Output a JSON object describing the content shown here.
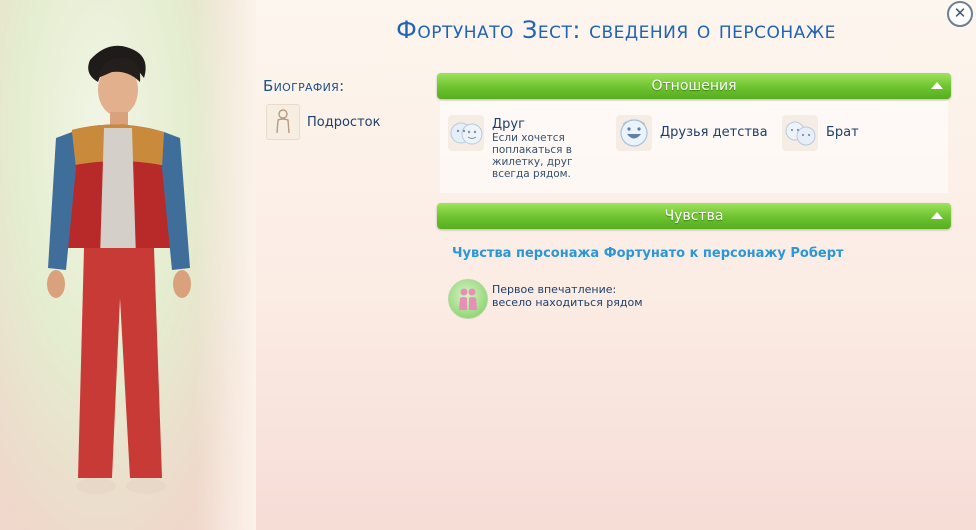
{
  "window": {
    "title": "Фортунато Зест: сведения о персонаже",
    "close_symbol": "✕"
  },
  "biography": {
    "heading": "Биография:",
    "age_label": "Подросток",
    "age_icon": "teen-figure-icon"
  },
  "relationships": {
    "header": "Отношения",
    "items": [
      {
        "title": "Друг",
        "description": "Если хочется поплакаться в жилетку, друг всегда рядом.",
        "icon": "friends-faces-icon"
      },
      {
        "title": "Друзья детства",
        "description": "",
        "icon": "smiling-face-icon"
      },
      {
        "title": "Брат",
        "description": "",
        "icon": "sibling-faces-icon"
      }
    ]
  },
  "feelings": {
    "header": "Чувства",
    "subtitle": "Чувства персонажа Фортунато к персонажу Роберт",
    "first_impression_line1": "Первое впечатление:",
    "first_impression_line2": "весело находиться рядом",
    "icon": "two-people-icon"
  },
  "colors": {
    "title": "#1f63b8",
    "header_green": "#6dc22f",
    "feelings_link": "#2b97d7"
  }
}
